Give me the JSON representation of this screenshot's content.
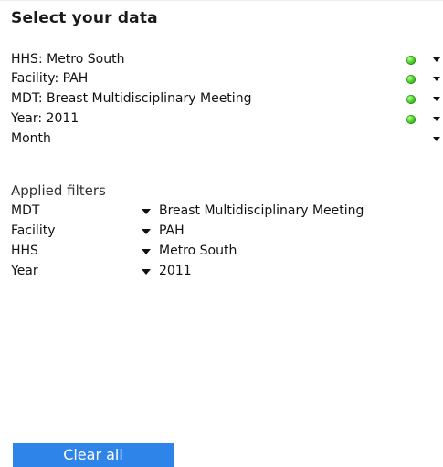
{
  "title": "Select your data",
  "selectors": [
    {
      "label": "HHS: Metro South",
      "has_status": true,
      "status_color": "#42c62a"
    },
    {
      "label": "Facility: PAH",
      "has_status": true,
      "status_color": "#42c62a"
    },
    {
      "label": "MDT: Breast Multidisciplinary Meeting",
      "has_status": true,
      "status_color": "#42c62a"
    },
    {
      "label": "Year: 2011",
      "has_status": true,
      "status_color": "#42c62a"
    },
    {
      "label": "Month",
      "has_status": false
    }
  ],
  "applied_filters": {
    "title": "Applied filters",
    "rows": [
      {
        "key": "MDT",
        "value": "Breast Multidisciplinary Meeting"
      },
      {
        "key": "Facility",
        "value": "PAH"
      },
      {
        "key": "HHS",
        "value": "Metro South"
      },
      {
        "key": "Year",
        "value": "2011"
      }
    ]
  },
  "clear_all_label": "Clear all",
  "colors": {
    "accent": "#2e84e8",
    "status_green": "#42c62a",
    "text": "#111111"
  },
  "icons": {
    "status": "green-status-dot-icon",
    "dropdown": "dropdown-arrow-icon"
  }
}
